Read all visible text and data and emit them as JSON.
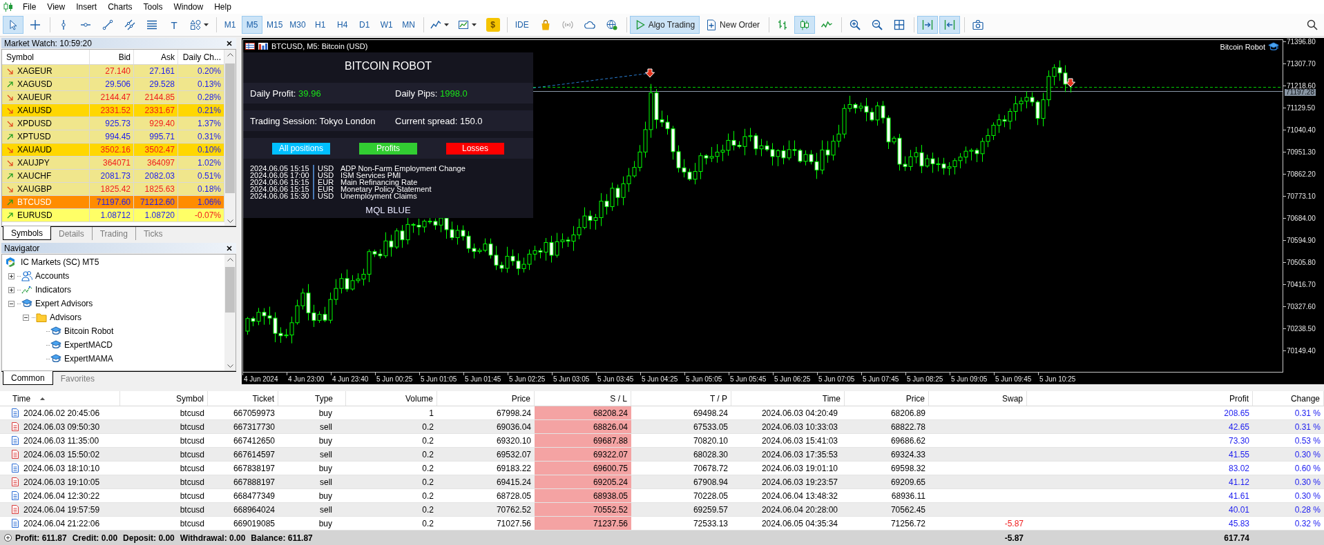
{
  "menu": {
    "items": [
      "File",
      "View",
      "Insert",
      "Charts",
      "Tools",
      "Window",
      "Help"
    ]
  },
  "toolbar": {
    "groups": [
      [
        {
          "kind": "cursor",
          "selected": true
        },
        {
          "kind": "crosshair",
          "selected": false
        }
      ],
      [
        {
          "kind": "vertical-line",
          "selected": false
        },
        {
          "kind": "horizontal-line",
          "selected": false
        },
        {
          "kind": "trend-line",
          "selected": false
        },
        {
          "kind": "channel",
          "selected": false
        },
        {
          "kind": "fibonacci",
          "selected": false
        },
        {
          "kind": "text",
          "label": "T",
          "selected": false
        },
        {
          "kind": "shapes",
          "selected": false
        }
      ],
      [
        {
          "kind": "timeframe",
          "label": "M1",
          "selected": false
        },
        {
          "kind": "timeframe",
          "label": "M5",
          "selected": true
        },
        {
          "kind": "timeframe",
          "label": "M15",
          "selected": false
        },
        {
          "kind": "timeframe",
          "label": "M30",
          "selected": false
        },
        {
          "kind": "timeframe",
          "label": "H1",
          "selected": false
        },
        {
          "kind": "timeframe",
          "label": "H4",
          "selected": false
        },
        {
          "kind": "timeframe",
          "label": "D1",
          "selected": false
        },
        {
          "kind": "timeframe",
          "label": "W1",
          "selected": false
        },
        {
          "kind": "timeframe",
          "label": "MN",
          "selected": false
        }
      ],
      [
        {
          "kind": "chart-type"
        },
        {
          "kind": "indicators"
        },
        {
          "kind": "dollar",
          "label": "$"
        }
      ],
      [
        {
          "kind": "ide",
          "label": "IDE"
        },
        {
          "kind": "market"
        },
        {
          "kind": "signals"
        },
        {
          "kind": "cloud"
        },
        {
          "kind": "vps"
        }
      ],
      [
        {
          "kind": "algo",
          "label": "Algo Trading",
          "on": true
        },
        {
          "kind": "order",
          "label": "New Order",
          "on": false
        }
      ],
      [
        {
          "kind": "bars",
          "selected": false
        },
        {
          "kind": "candles",
          "selected": true
        },
        {
          "kind": "line",
          "selected": false
        }
      ],
      [
        {
          "kind": "zoom-in"
        },
        {
          "kind": "zoom-out"
        },
        {
          "kind": "tile"
        }
      ],
      [
        {
          "kind": "autoscroll",
          "on": true
        },
        {
          "kind": "shift",
          "on": true
        }
      ],
      [
        {
          "kind": "screenshot"
        }
      ]
    ]
  },
  "market_watch": {
    "title": "Market Watch: 10:59:20",
    "columns": [
      "Symbol",
      "Bid",
      "Ask",
      "Daily Ch..."
    ],
    "rows": [
      {
        "symbol": "XAGEUR",
        "rising": false,
        "bid": "27.140",
        "bid_up": false,
        "ask": "27.161",
        "ask_up": true,
        "change": "0.20%",
        "change_up": true,
        "color": "#f0e68c",
        "selected": false
      },
      {
        "symbol": "XAGUSD",
        "rising": true,
        "bid": "29.506",
        "bid_up": true,
        "ask": "29.528",
        "ask_up": true,
        "change": "0.13%",
        "change_up": true,
        "color": "#f0e68c",
        "selected": false
      },
      {
        "symbol": "XAUEUR",
        "rising": false,
        "bid": "2144.47",
        "bid_up": false,
        "ask": "2144.85",
        "ask_up": false,
        "change": "0.28%",
        "change_up": true,
        "color": "#f0e68c",
        "selected": false
      },
      {
        "symbol": "XAUUSD",
        "rising": false,
        "bid": "2331.52",
        "bid_up": false,
        "ask": "2331.67",
        "ask_up": false,
        "change": "0.21%",
        "change_up": true,
        "color": "#ffd700",
        "selected": false
      },
      {
        "symbol": "XPDUSD",
        "rising": false,
        "bid": "925.73",
        "bid_up": true,
        "ask": "929.40",
        "ask_up": false,
        "change": "1.37%",
        "change_up": true,
        "color": "#f0e68c",
        "selected": false
      },
      {
        "symbol": "XPTUSD",
        "rising": true,
        "bid": "994.45",
        "bid_up": true,
        "ask": "995.71",
        "ask_up": true,
        "change": "0.31%",
        "change_up": true,
        "color": "#f0e68c",
        "selected": false
      },
      {
        "symbol": "XAUAUD",
        "rising": false,
        "bid": "3502.16",
        "bid_up": false,
        "ask": "3502.47",
        "ask_up": false,
        "change": "0.10%",
        "change_up": true,
        "color": "#ffd700",
        "selected": false
      },
      {
        "symbol": "XAUJPY",
        "rising": false,
        "bid": "364071",
        "bid_up": false,
        "ask": "364097",
        "ask_up": false,
        "change": "1.02%",
        "change_up": true,
        "color": "#f0e68c",
        "selected": false
      },
      {
        "symbol": "XAUCHF",
        "rising": true,
        "bid": "2081.73",
        "bid_up": true,
        "ask": "2082.03",
        "ask_up": true,
        "change": "0.51%",
        "change_up": true,
        "color": "#f0e68c",
        "selected": false
      },
      {
        "symbol": "XAUGBP",
        "rising": false,
        "bid": "1825.42",
        "bid_up": false,
        "ask": "1825.63",
        "ask_up": false,
        "change": "0.18%",
        "change_up": true,
        "color": "#f0e68c",
        "selected": false
      },
      {
        "symbol": "BTCUSD",
        "rising": true,
        "bid": "71197.60",
        "bid_up": true,
        "ask": "71212.60",
        "ask_up": true,
        "change": "1.06%",
        "change_up": true,
        "color": "#ff8c00",
        "selected": true
      },
      {
        "symbol": "EURUSD",
        "rising": true,
        "bid": "1.08712",
        "bid_up": true,
        "ask": "1.08720",
        "ask_up": true,
        "change": "-0.07%",
        "change_up": false,
        "color": "#ffff66",
        "selected": false
      }
    ],
    "tabs": [
      {
        "label": "Symbols",
        "selected": true
      },
      {
        "label": "Details",
        "selected": false
      },
      {
        "label": "Trading",
        "selected": false
      },
      {
        "label": "Ticks",
        "selected": false
      }
    ]
  },
  "navigator": {
    "title": "Navigator",
    "tree": [
      {
        "label": "IC Markets (SC) MT5",
        "kind": "broker",
        "children": [
          {
            "label": "Accounts",
            "kind": "accounts",
            "expanded": false
          },
          {
            "label": "Indicators",
            "kind": "indicators",
            "expanded": false
          },
          {
            "label": "Expert Advisors",
            "kind": "experts",
            "expanded": true,
            "children": [
              {
                "label": "Advisors",
                "kind": "folder",
                "expanded": true,
                "children": [
                  {
                    "label": "Bitcoin Robot",
                    "kind": "expert"
                  },
                  {
                    "label": "ExpertMACD",
                    "kind": "expert"
                  },
                  {
                    "label": "ExpertMAMA",
                    "kind": "expert"
                  }
                ]
              }
            ]
          }
        ]
      }
    ],
    "tabs": [
      {
        "label": "Common",
        "selected": true
      },
      {
        "label": "Favorites",
        "selected": false
      }
    ]
  },
  "chart": {
    "title": "BTCUSD, M5: Bitcoin (USD)",
    "expert": "Bitcoin Robot",
    "robot_panel": {
      "title": "BITCOIN ROBOT",
      "rows": [
        [
          {
            "label": "Daily Profit:",
            "value": "39.96",
            "kind": "gain"
          },
          {
            "label": "Daily Pips:",
            "value": "1998.0",
            "kind": "gain"
          }
        ],
        [
          {
            "label": "Trading Session:",
            "value": "Tokyo London",
            "kind": "info"
          },
          {
            "label": "Current spread:",
            "value": "150.0",
            "kind": "info"
          }
        ]
      ],
      "buttons": [
        {
          "label": "All positions",
          "color": "#00bfff"
        },
        {
          "label": "Profits",
          "color": "#32cd32"
        },
        {
          "label": "Losses",
          "color": "#ff0000"
        }
      ],
      "news": [
        {
          "time": "2024.06.05 15:15",
          "currency": "USD",
          "event": "ADP Non-Farm Employment Change"
        },
        {
          "time": "2024.06.05 17:00",
          "currency": "USD",
          "event": "ISM Services PMI"
        },
        {
          "time": "2024.06.06 15:15",
          "currency": "EUR",
          "event": "Main Refinancing Rate"
        },
        {
          "time": "2024.06.06 15:15",
          "currency": "EUR",
          "event": "Monetary Policy Statement"
        },
        {
          "time": "2024.06.06 15:30",
          "currency": "USD",
          "event": "Unemployment Claims"
        }
      ],
      "footer": "MQL BLUE"
    },
    "price_labels": [
      "71396.80",
      "71307.70",
      "71218.60",
      "71129.50",
      "71040.40",
      "70951.30",
      "70862.20",
      "70773.10",
      "70684.00",
      "70594.90",
      "70505.80",
      "70416.70",
      "70327.60",
      "70238.50",
      "70149.40"
    ],
    "current_price": "71197.28",
    "time_labels": [
      "4 Jun 2024",
      "4 Jun 23:00",
      "4 Jun 23:40",
      "5 Jun 00:25",
      "5 Jun 01:05",
      "5 Jun 01:45",
      "5 Jun 02:25",
      "5 Jun 03:05",
      "5 Jun 03:45",
      "5 Jun 04:25",
      "5 Jun 05:05",
      "5 Jun 05:45",
      "5 Jun 06:25",
      "5 Jun 07:05",
      "5 Jun 07:45",
      "5 Jun 08:25",
      "5 Jun 09:05",
      "5 Jun 09:45",
      "5 Jun 10:25"
    ]
  },
  "trades": {
    "columns": [
      {
        "label": "Time",
        "sorted": true
      },
      {
        "label": "Symbol",
        "sorted": false
      },
      {
        "label": "Ticket",
        "sorted": false
      },
      {
        "label": "Type",
        "sorted": false
      },
      {
        "label": "Volume",
        "sorted": false
      },
      {
        "label": "Price",
        "sorted": false
      },
      {
        "label": "S / L",
        "sorted": false
      },
      {
        "label": "T / P",
        "sorted": false
      },
      {
        "label": "Time",
        "sorted": false
      },
      {
        "label": "Price",
        "sorted": false
      },
      {
        "label": "Swap",
        "sorted": false
      },
      {
        "label": "Profit",
        "sorted": false
      },
      {
        "label": "Change",
        "sorted": false
      }
    ],
    "rows": [
      {
        "kind": "buy",
        "time": "2024.06.02 20:45:06",
        "symbol": "btcusd",
        "ticket": "667059973",
        "type": "buy",
        "volume": "1",
        "price": "67998.24",
        "sl": "68208.24",
        "tp": "69498.24",
        "close_time": "2024.06.03 04:20:49",
        "close_price": "68206.89",
        "profit": "208.65",
        "change": "0.31 %"
      },
      {
        "kind": "sell",
        "time": "2024.06.03 09:50:30",
        "symbol": "btcusd",
        "ticket": "667317730",
        "type": "sell",
        "volume": "0.2",
        "price": "69036.04",
        "sl": "68826.04",
        "tp": "67533.05",
        "close_time": "2024.06.03 10:33:03",
        "close_price": "68822.78",
        "profit": "42.65",
        "change": "0.31 %"
      },
      {
        "kind": "buy",
        "time": "2024.06.03 11:35:00",
        "symbol": "btcusd",
        "ticket": "667412650",
        "type": "buy",
        "volume": "0.2",
        "price": "69320.10",
        "sl": "69687.88",
        "tp": "70820.10",
        "close_time": "2024.06.03 15:41:03",
        "close_price": "69686.62",
        "profit": "73.30",
        "change": "0.53 %"
      },
      {
        "kind": "sell",
        "time": "2024.06.03 15:50:02",
        "symbol": "btcusd",
        "ticket": "667614597",
        "type": "sell",
        "volume": "0.2",
        "price": "69532.07",
        "sl": "69322.07",
        "tp": "68028.30",
        "close_time": "2024.06.03 17:35:53",
        "close_price": "69324.33",
        "profit": "41.55",
        "change": "0.30 %"
      },
      {
        "kind": "buy",
        "time": "2024.06.03 18:10:10",
        "symbol": "btcusd",
        "ticket": "667838197",
        "type": "buy",
        "volume": "0.2",
        "price": "69183.22",
        "sl": "69600.75",
        "tp": "70678.72",
        "close_time": "2024.06.03 19:01:10",
        "close_price": "69598.32",
        "profit": "83.02",
        "change": "0.60 %"
      },
      {
        "kind": "sell",
        "time": "2024.06.03 19:10:05",
        "symbol": "btcusd",
        "ticket": "667888197",
        "type": "sell",
        "volume": "0.2",
        "price": "69415.24",
        "sl": "69205.24",
        "tp": "67908.94",
        "close_time": "2024.06.03 19:23:57",
        "close_price": "69209.65",
        "profit": "41.12",
        "change": "0.30 %"
      },
      {
        "kind": "buy",
        "time": "2024.06.04 12:30:22",
        "symbol": "btcusd",
        "ticket": "668477349",
        "type": "buy",
        "volume": "0.2",
        "price": "68728.05",
        "sl": "68938.05",
        "tp": "70228.05",
        "close_time": "2024.06.04 13:48:32",
        "close_price": "68936.11",
        "profit": "41.61",
        "change": "0.30 %"
      },
      {
        "kind": "sell",
        "time": "2024.06.04 19:57:59",
        "symbol": "btcusd",
        "ticket": "668964024",
        "type": "sell",
        "volume": "0.2",
        "price": "70762.52",
        "sl": "70552.52",
        "tp": "69259.57",
        "close_time": "2024.06.04 20:28:00",
        "close_price": "70562.45",
        "profit": "40.01",
        "change": "0.28 %"
      },
      {
        "kind": "buy",
        "time": "2024.06.04 21:22:06",
        "symbol": "btcusd",
        "ticket": "669019085",
        "type": "buy",
        "volume": "0.2",
        "price": "71027.56",
        "sl": "71237.56",
        "tp": "72533.13",
        "close_time": "2024.06.05 04:35:34",
        "close_price": "71256.72",
        "swap": "-5.87",
        "profit": "45.83",
        "change": "0.32 %"
      }
    ],
    "summary": [
      "Profit: 611.87",
      "Credit: 0.00",
      "Deposit: 0.00",
      "Withdrawal: 0.00",
      "Balance: 611.87"
    ],
    "swap_total": "-5.87",
    "profit_total": "617.74"
  }
}
